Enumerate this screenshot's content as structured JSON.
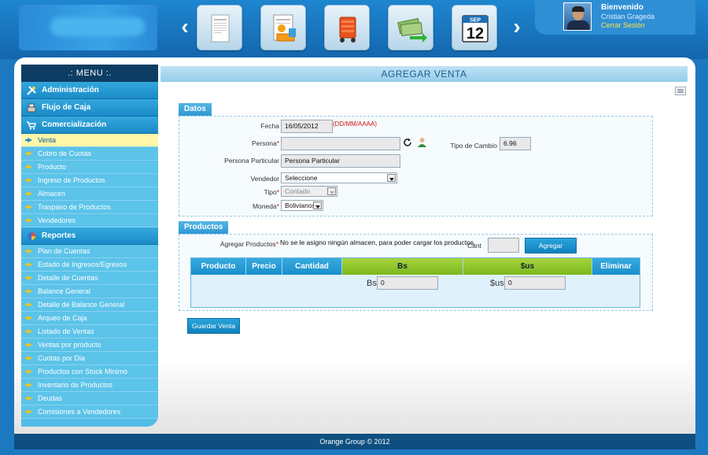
{
  "header": {
    "welcome": "Bienvenido",
    "user_name": "Cristian Grageda",
    "logout": "Cerrar Sesión",
    "nav_prev": "‹",
    "nav_next": "›",
    "tiles": [
      "receipt-icon",
      "invoice-icon",
      "shopping-cart-icon",
      "cash-icon",
      "calendar-icon"
    ],
    "calendar_month": "SEP",
    "calendar_day": "12"
  },
  "sidebar": {
    "title": ".: MENU :.",
    "sections": [
      {
        "label": "Administración",
        "icon": "tools-icon"
      },
      {
        "label": "Flujo de Caja",
        "icon": "cash-register-icon"
      },
      {
        "label": "Comercialización",
        "icon": "cart-icon"
      },
      {
        "label": "Reportes",
        "icon": "pie-chart-icon"
      }
    ],
    "comercializacion_items": [
      "Venta",
      "Cobro de Cuotas",
      "Producto",
      "Ingreso de Productos",
      "Almacen",
      "Traspaso de Productos",
      "Vendedores"
    ],
    "reportes_items": [
      "Plan de Cuentas",
      "Estado de Ingresos/Egresos",
      "Detalle de Cuentas",
      "Balance General",
      "Detalle de Balance General",
      "Arqueo de Caja",
      "Listado de Ventas",
      "Ventas por producto",
      "Cuotas por Dia",
      "Productos con Stock Minimo",
      "Inventario de Productos",
      "Deudas",
      "Comisiones a Vendedores"
    ]
  },
  "content": {
    "title": "AGREGAR VENTA",
    "datos": {
      "tab": "Datos",
      "fecha_label": "Fecha",
      "fecha_value": "16/05/2012",
      "fecha_hint": "(DD/MM/AAAA)",
      "persona_label": "Persona",
      "persona_particular_label": "Persona Particular",
      "persona_particular_value": "Persona Particular",
      "tipo_cambio_label": "Tipo de Cambio",
      "tipo_cambio_value": "6.96",
      "vendedor_label": "Vendedor",
      "vendedor_value": "Seleccione",
      "tipo_label": "Tipo",
      "tipo_value": "Contado",
      "moneda_label": "Moneda",
      "moneda_value": "Bolivianos",
      "req": "*"
    },
    "productos": {
      "tab": "Productos",
      "agregar_label": "Agregar Productos",
      "no_almacen_msg": "No se le asigno ningún almacen, para poder cargar los productos.",
      "cant_label": "Cant",
      "agregar_button": "Agregar",
      "columns": [
        "Producto",
        "Precio",
        "Cantidad",
        "Bs",
        "$us",
        "Eliminar"
      ],
      "bs_label": "Bs",
      "bs_value": "0",
      "us_label": "$us",
      "us_value": "0"
    },
    "guardar_button": "Guardar Venta"
  },
  "footer": {
    "text": "Orange Group © 2012"
  }
}
